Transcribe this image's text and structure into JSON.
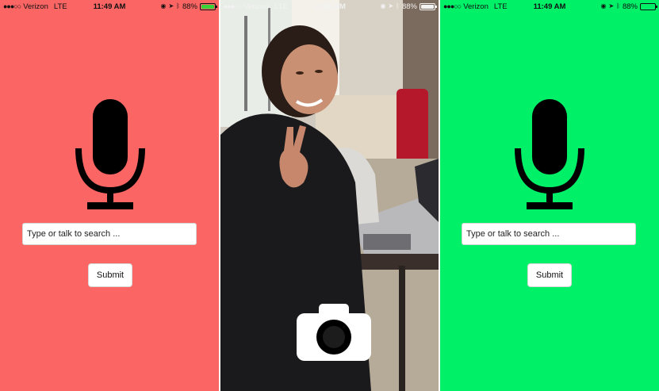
{
  "screens": [
    {
      "status": {
        "carrier": "Verizon",
        "network": "LTE",
        "time": "11:49 AM",
        "battery_text": "88%"
      },
      "search": {
        "placeholder": "Type or talk to search ..."
      },
      "submit_label": "Submit",
      "background": "#fb6563"
    },
    {
      "status": {
        "carrier": "Verizon",
        "network": "LTE",
        "time": "11:48 AM",
        "battery_text": "88%"
      },
      "camera_icon": "camera-icon"
    },
    {
      "status": {
        "carrier": "Verizon",
        "network": "LTE",
        "time": "11:49 AM",
        "battery_text": "88%"
      },
      "search": {
        "placeholder": "Type or talk to search ..."
      },
      "submit_label": "Submit",
      "background": "#00f068"
    }
  ],
  "icons": {
    "microphone": "microphone-icon",
    "camera": "camera-icon",
    "location": "location-arrow-icon",
    "bluetooth": "bluetooth-icon",
    "alarm": "alarm-icon"
  }
}
